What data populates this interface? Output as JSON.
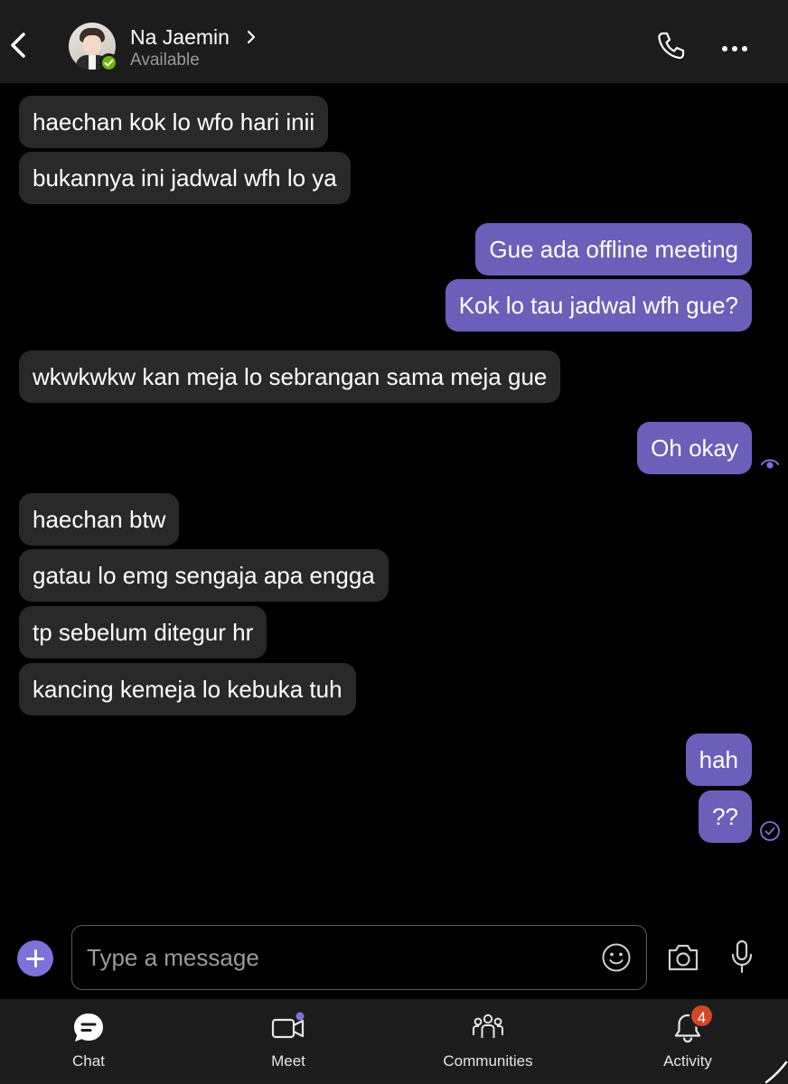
{
  "header": {
    "name": "Na Jaemin",
    "status": "Available",
    "icons": {
      "back": "chevron-left-icon",
      "name_chevron": "chevron-right-icon",
      "call": "phone-icon",
      "more": "more-horizontal-icon"
    },
    "presence_color": "#6bb700"
  },
  "messages": [
    {
      "dir": "in",
      "text": "haechan kok lo wfo hari inii"
    },
    {
      "dir": "in",
      "text": "bukannya ini jadwal wfh lo ya"
    },
    {
      "dir": "out",
      "text": "Gue ada offline meeting"
    },
    {
      "dir": "out",
      "text": "Kok lo tau jadwal wfh gue?"
    },
    {
      "dir": "in",
      "text": "wkwkwkw kan meja lo sebrangan sama meja gue"
    },
    {
      "dir": "out",
      "text": "Oh okay",
      "status_icon": "seen-eye-icon"
    },
    {
      "dir": "in",
      "text": "haechan btw"
    },
    {
      "dir": "in",
      "text": "gatau lo emg sengaja apa engga"
    },
    {
      "dir": "in",
      "text": "tp sebelum ditegur hr"
    },
    {
      "dir": "in",
      "text": "kancing kemeja lo kebuka tuh"
    },
    {
      "dir": "out",
      "text": "hah"
    },
    {
      "dir": "out",
      "text": "??",
      "status_icon": "sent-check-icon"
    }
  ],
  "composer": {
    "placeholder": "Type a message",
    "icons": {
      "add": "plus-icon",
      "emoji": "emoji-icon",
      "camera": "camera-icon",
      "mic": "microphone-icon"
    }
  },
  "tabs": [
    {
      "label": "Chat",
      "icon": "chat-icon"
    },
    {
      "label": "Meet",
      "icon": "video-icon"
    },
    {
      "label": "Communities",
      "icon": "communities-icon"
    },
    {
      "label": "Activity",
      "icon": "bell-icon",
      "badge": "4"
    }
  ],
  "colors": {
    "background": "#000000",
    "bar": "#1c1c1c",
    "incoming_bubble": "#292929",
    "outgoing_bubble": "#6b5fb9",
    "accent": "#7c72d8",
    "badge": "#d24726"
  }
}
